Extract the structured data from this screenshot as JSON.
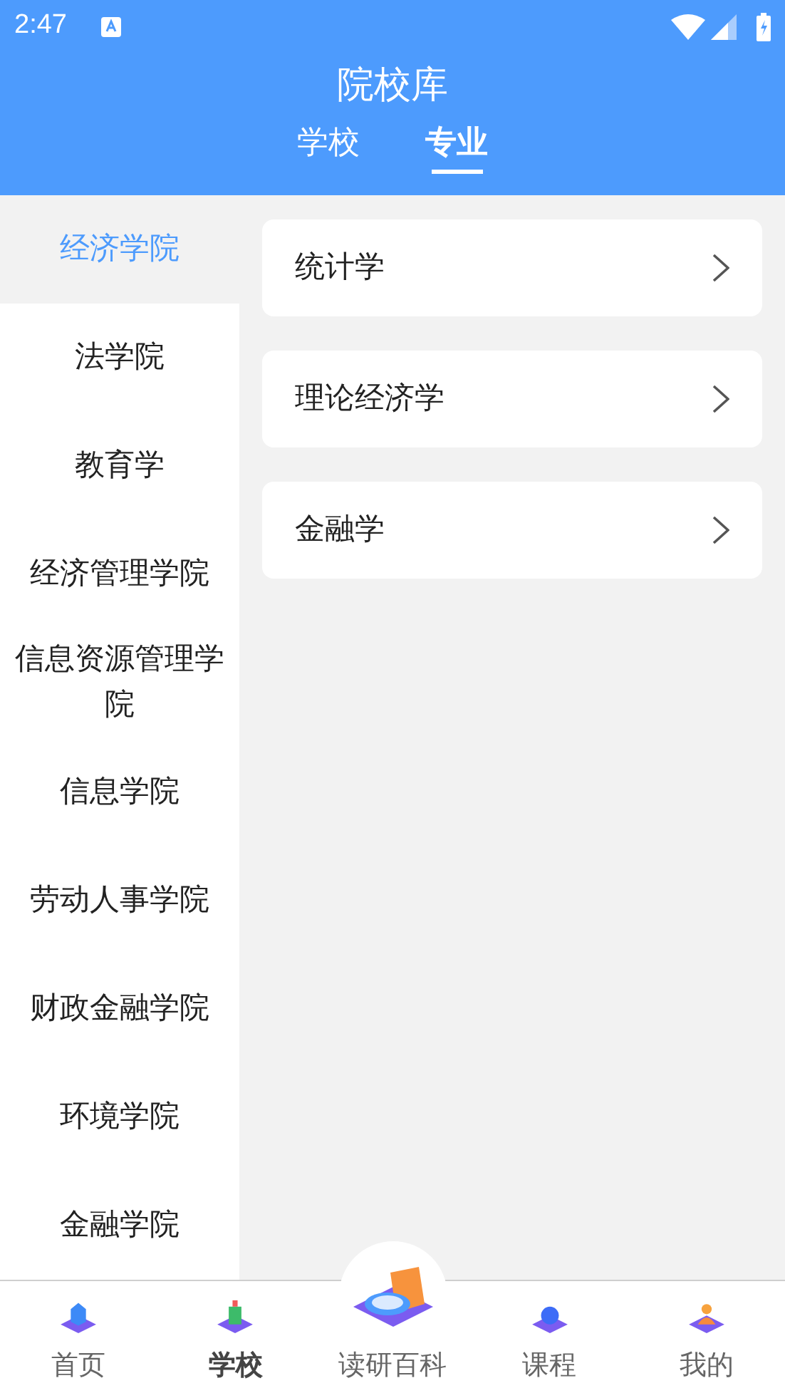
{
  "status_bar": {
    "time": "2:47"
  },
  "header": {
    "title": "院校库"
  },
  "tabs": [
    {
      "label": "学校",
      "selected": false
    },
    {
      "label": "专业",
      "selected": true
    }
  ],
  "sidebar": {
    "items": [
      {
        "label": "经济学院",
        "selected": true
      },
      {
        "label": "法学院",
        "selected": false
      },
      {
        "label": "教育学",
        "selected": false
      },
      {
        "label": "经济管理学院",
        "selected": false
      },
      {
        "label": "信息资源管理学院",
        "selected": false
      },
      {
        "label": "信息学院",
        "selected": false
      },
      {
        "label": "劳动人事学院",
        "selected": false
      },
      {
        "label": "财政金融学院",
        "selected": false
      },
      {
        "label": "环境学院",
        "selected": false
      },
      {
        "label": "金融学院",
        "selected": false
      }
    ]
  },
  "majors": [
    {
      "label": "统计学"
    },
    {
      "label": "理论经济学"
    },
    {
      "label": "金融学"
    }
  ],
  "bottom_nav": [
    {
      "label": "首页",
      "kind": "home",
      "selected": false
    },
    {
      "label": "学校",
      "kind": "school",
      "selected": true
    },
    {
      "label": "读研百科",
      "kind": "center",
      "selected": false
    },
    {
      "label": "课程",
      "kind": "course",
      "selected": false
    },
    {
      "label": "我的",
      "kind": "profile",
      "selected": false
    }
  ]
}
